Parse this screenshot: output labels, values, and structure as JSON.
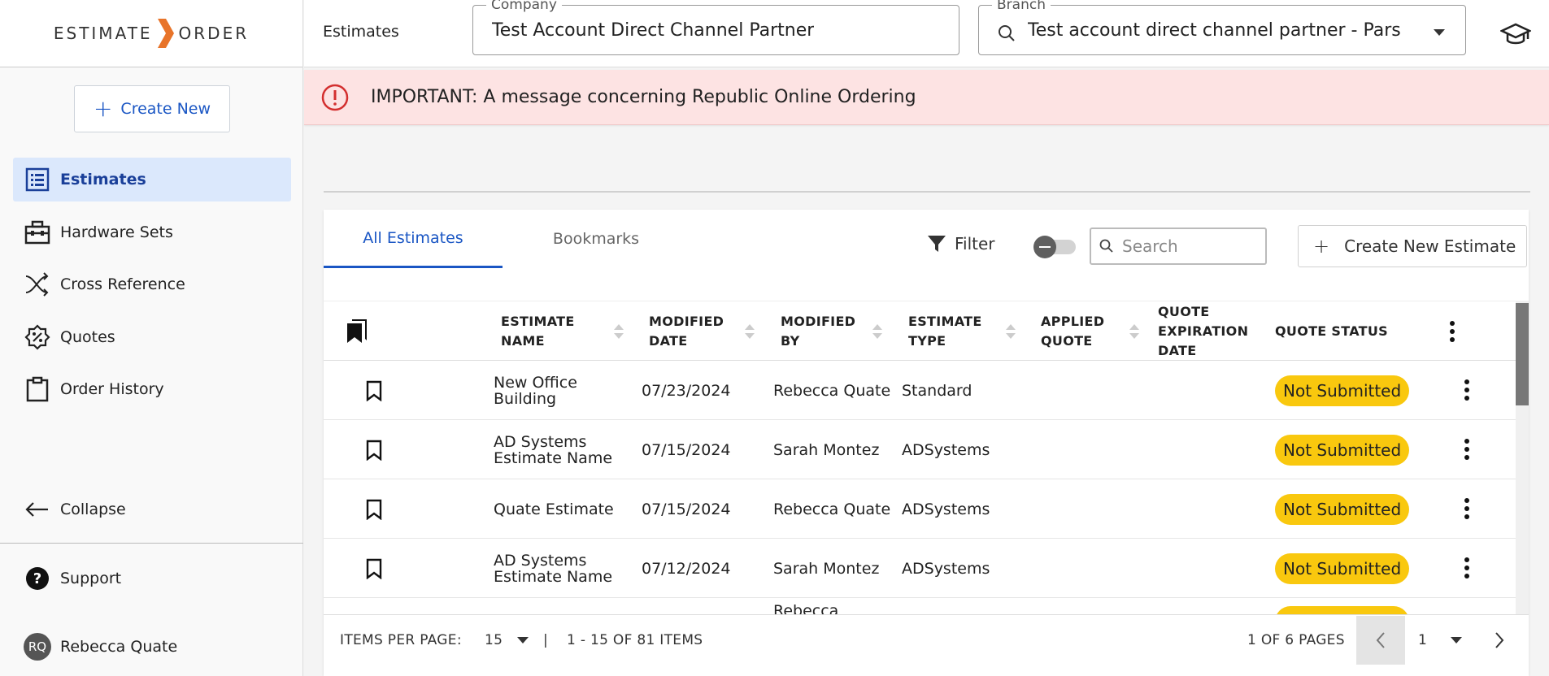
{
  "brand": {
    "left": "ESTIMATE",
    "right": "ORDER",
    "accent": "#e8742a"
  },
  "sidebar": {
    "create_label": "Create New",
    "items": [
      {
        "label": "Estimates",
        "icon": "list-icon",
        "active": true
      },
      {
        "label": "Hardware Sets",
        "icon": "toolbox-icon"
      },
      {
        "label": "Cross Reference",
        "icon": "shuffle-icon"
      },
      {
        "label": "Quotes",
        "icon": "percent-badge-icon"
      },
      {
        "label": "Order History",
        "icon": "clipboard-icon"
      }
    ],
    "collapse_label": "Collapse",
    "support_label": "Support",
    "user": {
      "initials": "RQ",
      "name": "Rebecca Quate"
    }
  },
  "header": {
    "title": "Estimates",
    "company": {
      "label": "Company",
      "value": "Test Account Direct Channel Partner"
    },
    "branch": {
      "label": "Branch",
      "value": "Test account direct channel partner - Pars"
    }
  },
  "alert": {
    "text": "IMPORTANT: A message concerning Republic Online Ordering",
    "color": "#d32f2f"
  },
  "tabs": [
    {
      "label": "All Estimates",
      "active": true
    },
    {
      "label": "Bookmarks",
      "active": false
    }
  ],
  "toolbar": {
    "filter_label": "Filter",
    "search_placeholder": "Search",
    "create_estimate_label": "Create New Estimate"
  },
  "table": {
    "columns": [
      "ESTIMATE NAME",
      "MODIFIED DATE",
      "MODIFIED BY",
      "ESTIMATE TYPE",
      "APPLIED QUOTE",
      "QUOTE EXPIRATION DATE",
      "QUOTE STATUS"
    ],
    "rows": [
      {
        "name": "New Office Building",
        "date": "07/23/2024",
        "by": "Rebecca Quate",
        "type": "Standard",
        "applied": "",
        "expiration": "",
        "status": "Not Submitted"
      },
      {
        "name": "AD Systems Estimate Name",
        "date": "07/15/2024",
        "by": "Sarah Montez",
        "type": "ADSystems",
        "applied": "",
        "expiration": "",
        "status": "Not Submitted"
      },
      {
        "name": "Quate Estimate",
        "date": "07/15/2024",
        "by": "Rebecca Quate",
        "type": "ADSystems",
        "applied": "",
        "expiration": "",
        "status": "Not Submitted"
      },
      {
        "name": "AD Systems Estimate Name",
        "date": "07/12/2024",
        "by": "Sarah Montez",
        "type": "ADSystems",
        "applied": "",
        "expiration": "",
        "status": "Not Submitted"
      },
      {
        "name": "",
        "date": "",
        "by": "Rebecca",
        "type": "",
        "applied": "",
        "expiration": "",
        "status": "Not Submitted"
      }
    ],
    "status_color": "#f9c80e"
  },
  "pagination": {
    "items_per_page_label": "ITEMS PER PAGE:",
    "items_per_page": "15",
    "separator": "|",
    "range": "1 - 15 OF 81 ITEMS",
    "pages": "1 OF 6 PAGES",
    "current_page": "1"
  }
}
